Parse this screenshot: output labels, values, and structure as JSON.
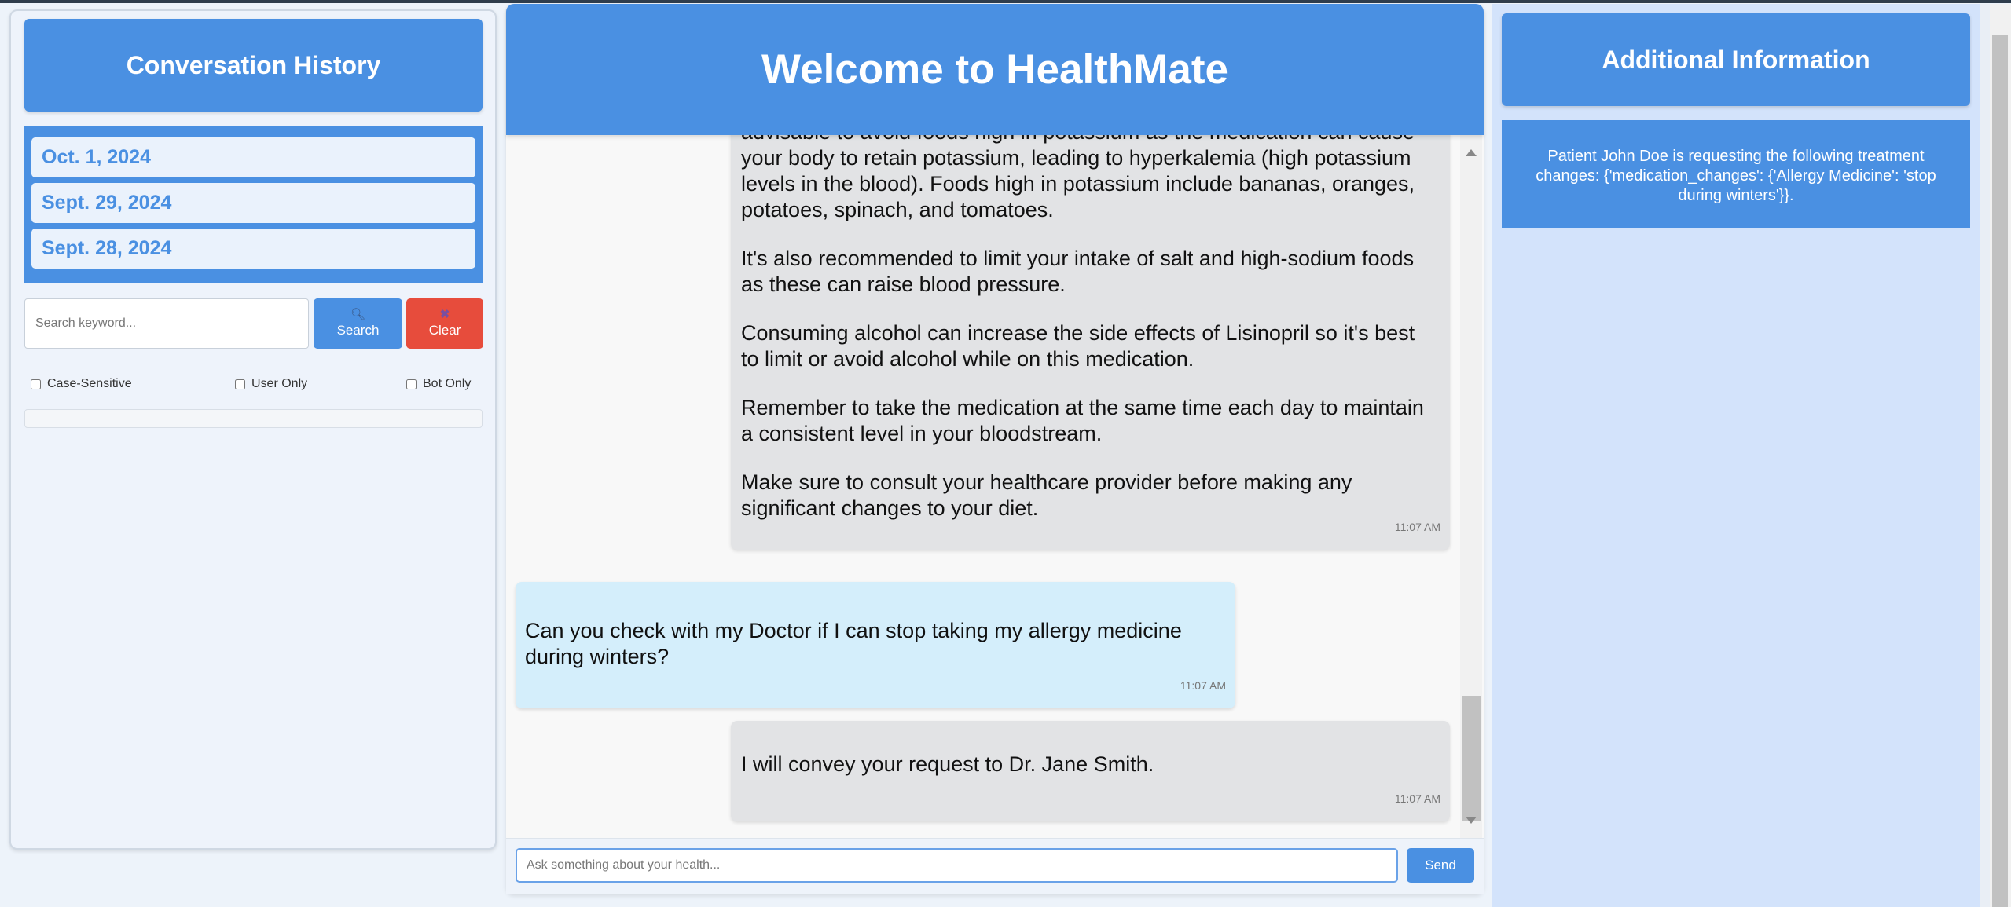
{
  "sidebar": {
    "title": "Conversation History",
    "dates": [
      "Oct. 1, 2024",
      "Sept. 29, 2024",
      "Sept. 28, 2024"
    ],
    "search_placeholder": "Search keyword...",
    "search_label": "Search",
    "clear_label": "Clear",
    "filters": {
      "case_sensitive": "Case-Sensitive",
      "user_only": "User Only",
      "bot_only": "Bot Only"
    }
  },
  "chat": {
    "title": "Welcome to HealthMate",
    "messages": [
      {
        "sender": "bot",
        "paragraphs": [
          "advisable to avoid foods high in potassium as the medication can cause your body to retain potassium, leading to hyperkalemia (high potassium levels in the blood). Foods high in potassium include bananas, oranges, potatoes, spinach, and tomatoes.",
          "It's also recommended to limit your intake of salt and high-sodium foods as these can raise blood pressure.",
          "Consuming alcohol can increase the side effects of Lisinopril so it's best to limit or avoid alcohol while on this medication.",
          "Remember to take the medication at the same time each day to maintain a consistent level in your bloodstream.",
          "Make sure to consult your healthcare provider before making any significant changes to your diet."
        ],
        "time": "11:07 AM"
      },
      {
        "sender": "user",
        "text": "Can you check with my Doctor if I can stop taking my allergy medicine during winters?",
        "time": "11:07 AM"
      },
      {
        "sender": "bot",
        "text": "I will convey your request to Dr. Jane Smith.",
        "time": "11:07 AM"
      }
    ],
    "input_placeholder": "Ask something about your health...",
    "send_label": "Send"
  },
  "info": {
    "title": "Additional Information",
    "text": "Patient John Doe is requesting the following treatment changes: {'medication_changes': {'Allergy Medicine': 'stop during winters'}}."
  },
  "colors": {
    "primary": "#4a90e2",
    "clear": "#e74c3c",
    "bot_bubble": "#e2e3e5",
    "user_bubble": "#d4eefb",
    "info_background": "#d3e3fb"
  },
  "icons": {
    "search": "magnifier-icon",
    "clear": "x-icon"
  }
}
